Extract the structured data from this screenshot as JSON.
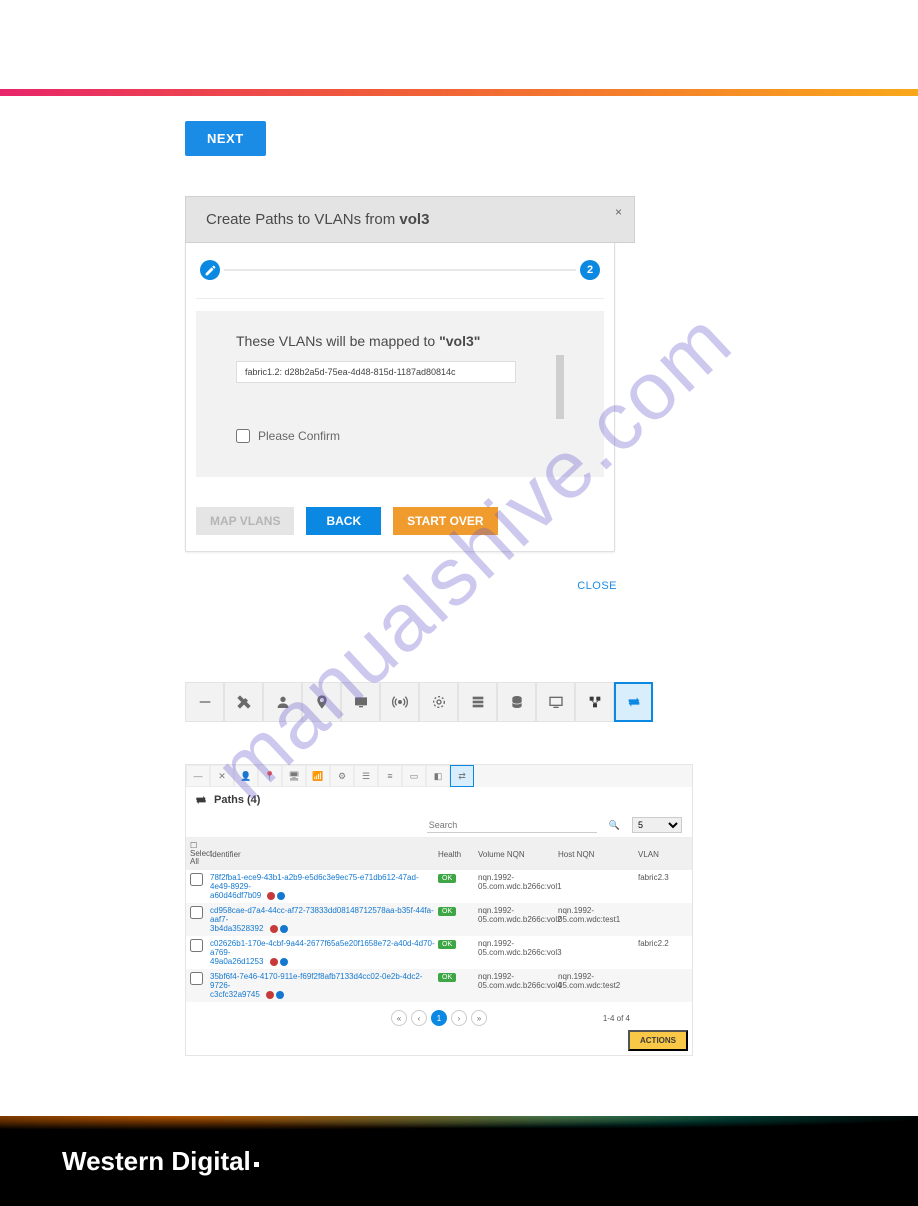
{
  "next_button": "NEXT",
  "dialog": {
    "title_prefix": "Create Paths to VLANs from ",
    "title_volume": "vol3",
    "close_x": "×",
    "step2_label": "2",
    "body_heading_prefix": "These VLANs will be mapped to ",
    "body_heading_volume": "\"vol3\"",
    "vlan_row": "fabric1.2: d28b2a5d-75ea-4d48-815d-1187ad80814c",
    "confirm_label": "Please Confirm",
    "btn_map": "MAP VLANS",
    "btn_back": "BACK",
    "btn_startover": "START OVER",
    "close_link": "CLOSE"
  },
  "toolbar_tools": [
    "minus",
    "tools",
    "user",
    "location",
    "monitor",
    "wireless",
    "gear",
    "storage",
    "database",
    "display",
    "topology",
    "paths"
  ],
  "paths": {
    "header": "Paths (4)",
    "search_placeholder": "Search",
    "page_size": "5",
    "col_select": "Select All",
    "col_identifier": "Identifier",
    "col_health": "Health",
    "col_volnqn": "Volume NQN",
    "col_hostnqn": "Host NQN",
    "col_vlan": "VLAN",
    "rows": [
      {
        "id": "78f2fba1-ece9-43b1-a2b9-e5d6c3e9ec75-e71db612-47ad-4e49-8929-",
        "id2": "a60d46df7b09",
        "health": "OK",
        "volnqn": "nqn.1992-05.com.wdc.b266c:vol1",
        "hostnqn": "",
        "vlan": "fabric2.3"
      },
      {
        "id": "cd958cae-d7a4-44cc-af72-73833dd08148712578aa-b35f-44fa-aaf7-",
        "id2": "3b4da3528392",
        "health": "OK",
        "volnqn": "nqn.1992-05.com.wdc.b266c:vol2",
        "hostnqn": "nqn.1992-05.com.wdc:test1",
        "vlan": ""
      },
      {
        "id": "c02626b1-170e-4cbf-9a44-2677f65a5e20f1658e72-a40d-4d70-a769-",
        "id2": "49a0a26d1253",
        "health": "OK",
        "volnqn": "nqn.1992-05.com.wdc.b266c:vol3",
        "hostnqn": "",
        "vlan": "fabric2.2"
      },
      {
        "id": "35bf6f4-7e46-4170-911e-f69f2f8afb7133d4cc02-0e2b-4dc2-9726-",
        "id2": "c3cfc32a9745",
        "health": "OK",
        "volnqn": "nqn.1992-05.com.wdc.b266c:vol4",
        "hostnqn": "nqn.1992-05.com.wdc:test2",
        "vlan": ""
      }
    ],
    "page_current": "1",
    "page_count": "1-4 of 4",
    "actions": "ACTIONS"
  },
  "watermark": "manualshive.com",
  "footer_brand": "Western Digital"
}
